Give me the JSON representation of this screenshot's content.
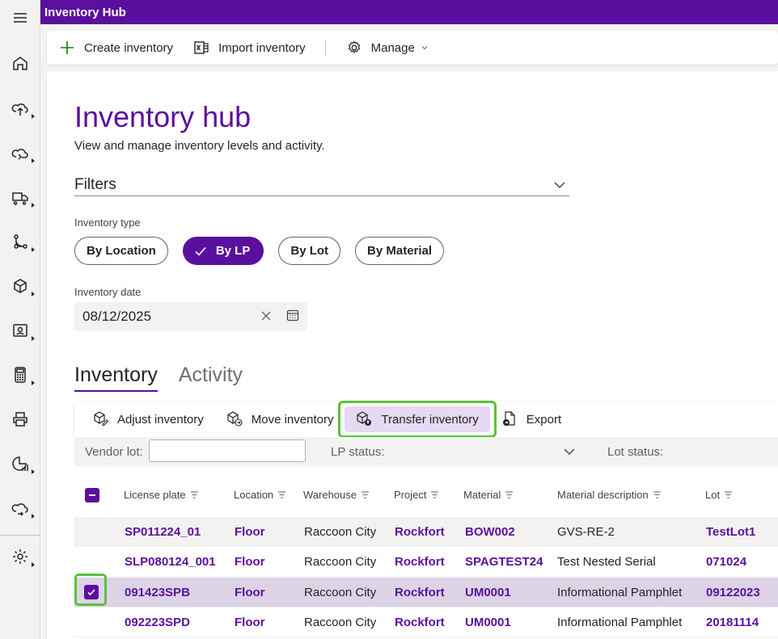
{
  "app": {
    "title": "Inventory Hub"
  },
  "rail": {
    "icons": [
      "menu-icon",
      "home-icon",
      "upload-icon",
      "cloud-import-icon",
      "truck-icon",
      "workflow-icon",
      "cube-icon",
      "badge-icon",
      "calculator-icon",
      "printer-icon",
      "analytics-icon",
      "cloud-sync-icon",
      "settings-icon"
    ]
  },
  "commandbar": {
    "create": "Create inventory",
    "import": "Import inventory",
    "manage": "Manage"
  },
  "page": {
    "title": "Inventory hub",
    "subtitle": "View and manage inventory levels and activity."
  },
  "filters": {
    "label": "Filters",
    "inventory_type_label": "Inventory type",
    "types": [
      "By Location",
      "By LP",
      "By Lot",
      "By Material"
    ],
    "selected_type": "By LP",
    "inventory_date_label": "Inventory date",
    "inventory_date": "08/12/2025"
  },
  "tabs": [
    "Inventory",
    "Activity"
  ],
  "active_tab": "Inventory",
  "toolbar": {
    "adjust": "Adjust inventory",
    "move": "Move inventory",
    "transfer": "Transfer inventory",
    "export": "Export"
  },
  "column_filters": {
    "vendor_lot_label": "Vendor lot:",
    "vendor_lot_value": "",
    "lp_status_label": "LP status:",
    "lot_status_label": "Lot status:"
  },
  "table": {
    "columns": [
      "License plate",
      "Location",
      "Warehouse",
      "Project",
      "Material",
      "Material description",
      "Lot"
    ],
    "rows": [
      {
        "license_plate": "SP011224_01",
        "location": "Floor",
        "warehouse": "Raccoon City",
        "project": "Rockfort",
        "material": "BOW002",
        "description": "GVS-RE-2",
        "lot": "TestLot1",
        "selected": false
      },
      {
        "license_plate": "SLP080124_001",
        "location": "Floor",
        "warehouse": "Raccoon City",
        "project": "Rockfort",
        "material": "SPAGTEST24",
        "description": "Test Nested Serial",
        "lot": "071024",
        "selected": false
      },
      {
        "license_plate": "091423SPB",
        "location": "Floor",
        "warehouse": "Raccoon City",
        "project": "Rockfort",
        "material": "UM0001",
        "description": "Informational Pamphlet",
        "lot": "09122023",
        "selected": true
      },
      {
        "license_plate": "092223SPD",
        "location": "Floor",
        "warehouse": "Raccoon City",
        "project": "Rockfort",
        "material": "UM0001",
        "description": "Informational Pamphlet",
        "lot": "20181114",
        "selected": false
      }
    ]
  },
  "colors": {
    "brand": "#5b0f9e",
    "highlight": "#5ac23a",
    "selected_row": "#dcd3e6"
  }
}
